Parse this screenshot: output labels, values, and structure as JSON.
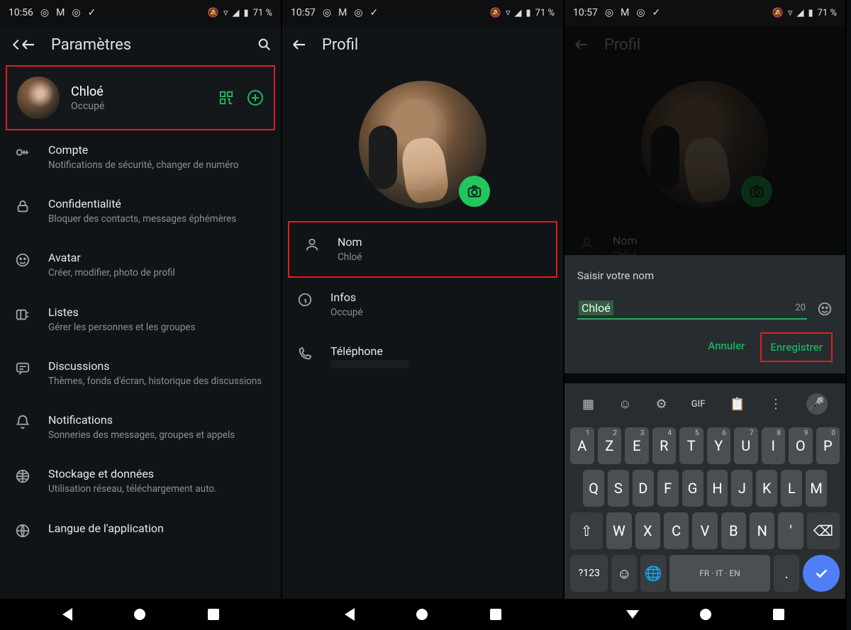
{
  "status": {
    "time_a": "10:56",
    "time_b": "10:57",
    "time_c": "10:57",
    "battery": "71 %"
  },
  "screen1": {
    "title": "Paramètres",
    "profile": {
      "name": "Chloé",
      "status": "Occupé"
    },
    "items": [
      {
        "title": "Compte",
        "sub": "Notifications de sécurité, changer de numéro"
      },
      {
        "title": "Confidentialité",
        "sub": "Bloquer des contacts, messages éphémères"
      },
      {
        "title": "Avatar",
        "sub": "Créer, modifier, photo de profil"
      },
      {
        "title": "Listes",
        "sub": "Gérer les personnes et les groupes"
      },
      {
        "title": "Discussions",
        "sub": "Thèmes, fonds d'écran, historique des discussions"
      },
      {
        "title": "Notifications",
        "sub": "Sonneries des messages, groupes et appels"
      },
      {
        "title": "Stockage et données",
        "sub": "Utilisation réseau, téléchargement auto."
      },
      {
        "title": "Langue de l'application",
        "sub": ""
      }
    ]
  },
  "screen2": {
    "title": "Profil",
    "rows": [
      {
        "title": "Nom",
        "sub": "Chloé"
      },
      {
        "title": "Infos",
        "sub": "Occupé"
      },
      {
        "title": "Téléphone",
        "sub": ""
      }
    ]
  },
  "screen3": {
    "title": "Profil",
    "nom_label": "Nom",
    "nom_value_under": "Chloé",
    "dialog": {
      "prompt": "Saisir votre nom",
      "value": "Chloé",
      "remaining": "20",
      "cancel": "Annuler",
      "save": "Enregistrer"
    },
    "keyboard": {
      "space_label": "FR · IT · EN",
      "symbols_label": "?123",
      "gif_label": "GIF",
      "row1": [
        "A",
        "Z",
        "E",
        "R",
        "T",
        "Y",
        "U",
        "I",
        "O",
        "P"
      ],
      "row1_sup": [
        "1",
        "2",
        "3",
        "4",
        "5",
        "6",
        "7",
        "8",
        "9",
        "0"
      ],
      "row2": [
        "Q",
        "S",
        "D",
        "F",
        "G",
        "H",
        "J",
        "K",
        "L",
        "M"
      ],
      "row3": [
        "W",
        "X",
        "C",
        "V",
        "B",
        "N"
      ]
    }
  }
}
